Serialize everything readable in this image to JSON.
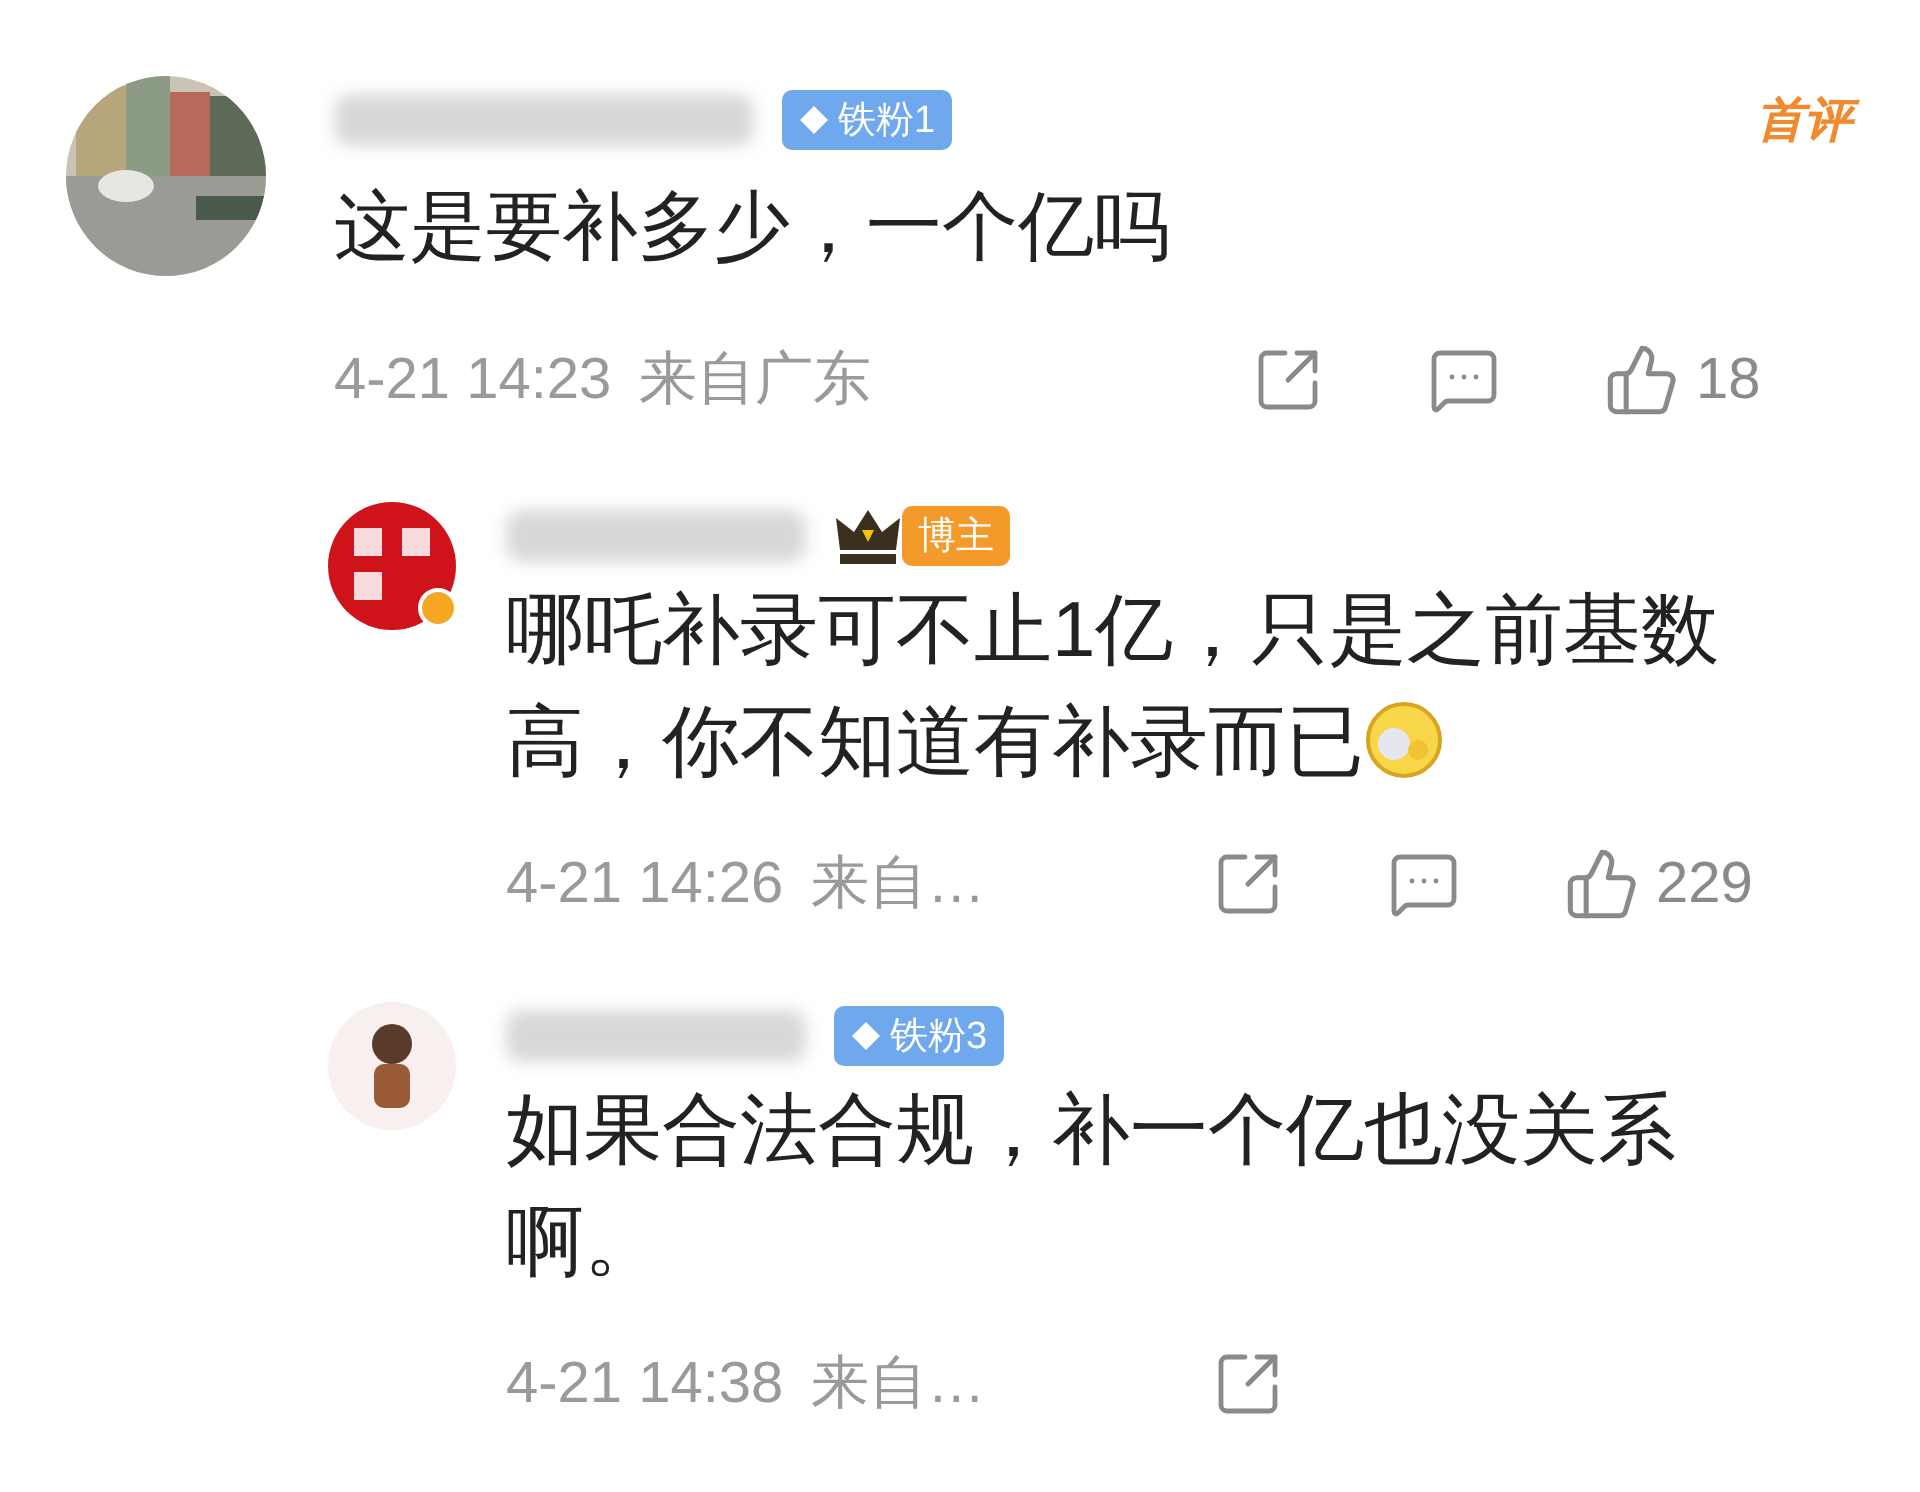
{
  "comments": [
    {
      "badge": {
        "kind": "fan",
        "label": "铁粉1"
      },
      "tag": "首评",
      "text": "这是要补多少，一个亿吗",
      "emoji": false,
      "time": "4-21 14:23",
      "location": "来自广东",
      "actions": [
        {
          "kind": "share"
        },
        {
          "kind": "comment"
        },
        {
          "kind": "like",
          "count": "18"
        }
      ]
    },
    {
      "avatar": {
        "kind": "seal"
      },
      "badge": {
        "kind": "author",
        "label": "博主"
      },
      "text": "哪吒补录可不止1亿，只是之前基数高，你不知道有补录而已",
      "emoji": true,
      "time": "4-21 14:26",
      "location": "来自…",
      "actions": [
        {
          "kind": "share"
        },
        {
          "kind": "comment"
        },
        {
          "kind": "like",
          "count": "229"
        }
      ]
    },
    {
      "avatar": {
        "kind": "figure"
      },
      "badge": {
        "kind": "fan",
        "label": "铁粉3"
      },
      "text": "如果合法合规，补一个亿也没关系啊。",
      "emoji": false,
      "time": "4-21 14:38",
      "location": "来自…",
      "actions": [
        {
          "kind": "share"
        }
      ]
    }
  ]
}
